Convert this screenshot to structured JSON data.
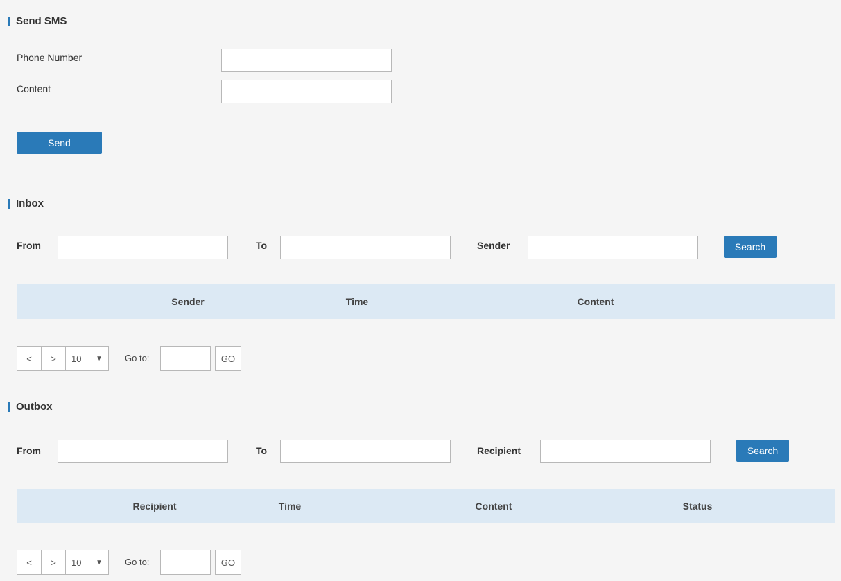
{
  "send_sms": {
    "title": "Send SMS",
    "phone_label": "Phone Number",
    "phone_value": "",
    "content_label": "Content",
    "content_value": "",
    "send_button": "Send"
  },
  "inbox": {
    "title": "Inbox",
    "from_label": "From",
    "to_label": "To",
    "sender_label": "Sender",
    "search_button": "Search",
    "columns": [
      "Sender",
      "Time",
      "Content"
    ],
    "pager": {
      "prev": "<",
      "next": ">",
      "page_size": "10",
      "page_size_arrow": "▼",
      "goto_label": "Go to:",
      "go_button": "GO"
    }
  },
  "outbox": {
    "title": "Outbox",
    "from_label": "From",
    "to_label": "To",
    "recipient_label": "Recipient",
    "search_button": "Search",
    "columns": [
      "Recipient",
      "Time",
      "Content",
      "Status"
    ],
    "pager": {
      "prev": "<",
      "next": ">",
      "page_size": "10",
      "page_size_arrow": "▼",
      "goto_label": "Go to:",
      "go_button": "GO"
    }
  },
  "colors": {
    "accent": "#2a7ab8",
    "table_header": "#dce9f4",
    "background": "#f5f5f5"
  }
}
